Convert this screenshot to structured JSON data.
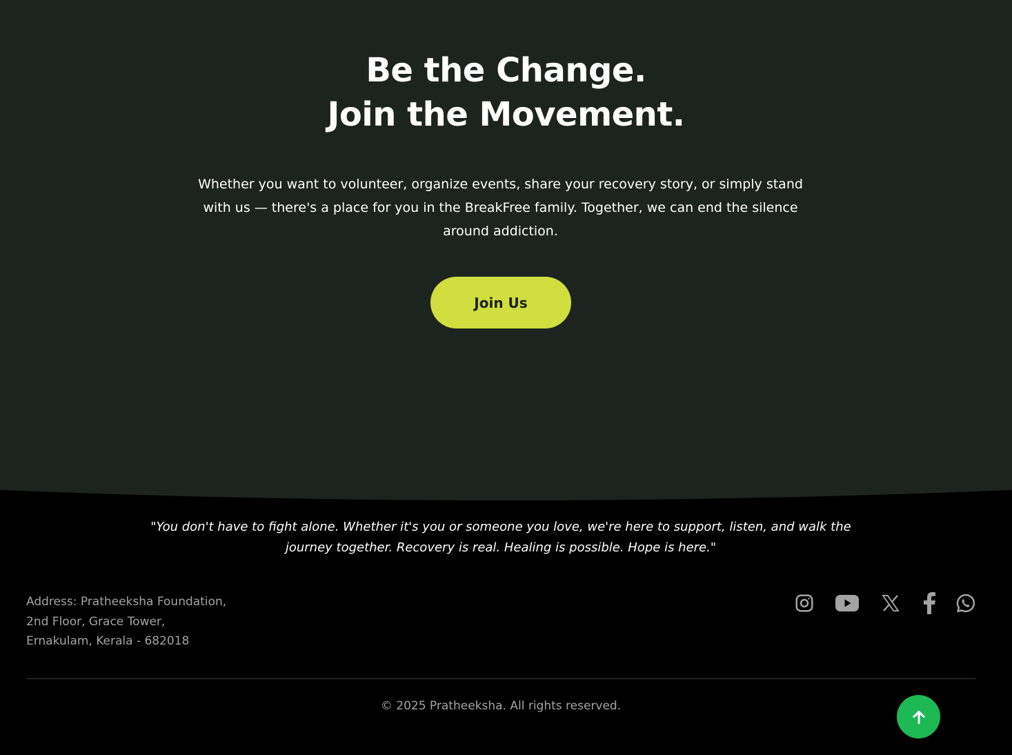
{
  "colors": {
    "cta_background": "#1d241f",
    "footer_background": "#000000",
    "cta_button": "#d0de3f",
    "cta_button_text": "#1d241f",
    "muted_text": "#a3a3a3",
    "back_to_top": "#1db954"
  },
  "cta": {
    "heading_line1": "Be the Change.",
    "heading_line2": "Join the Movement.",
    "description": "Whether you want to volunteer, organize events, share your recovery story, or simply stand with us — there's a place for you in the BreakFree family. Together, we can end the silence around addiction.",
    "button_label": "Join Us"
  },
  "footer": {
    "quote": "\"You don't have to fight alone. Whether it's you or someone you love, we're here to support, listen, and walk the journey together. Recovery is real. Healing is possible. Hope is here.\"",
    "address": {
      "line1": "Address: Pratheeksha Foundation,",
      "line2": "2nd Floor, Grace Tower,",
      "line3": "Ernakulam, Kerala - 682018"
    },
    "socials": [
      {
        "icon": "instagram-icon"
      },
      {
        "icon": "youtube-icon"
      },
      {
        "icon": "x-twitter-icon"
      },
      {
        "icon": "facebook-icon"
      },
      {
        "icon": "whatsapp-icon"
      }
    ],
    "copyright": "© 2025 Pratheeksha. All rights reserved.",
    "back_to_top_icon": "arrow-up-icon"
  }
}
